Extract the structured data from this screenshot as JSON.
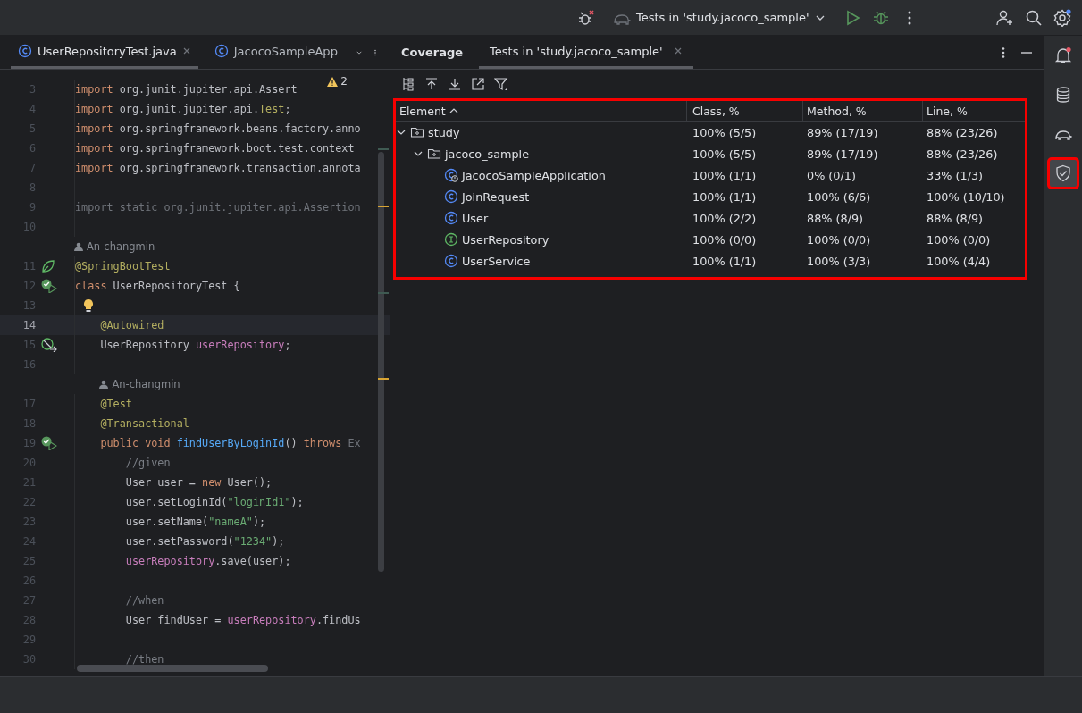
{
  "toolbar": {
    "run_config": "Tests in 'study.jacoco_sample'"
  },
  "editor": {
    "tabs": [
      {
        "label": "UserRepositoryTest.java",
        "selected": true,
        "closable": true
      },
      {
        "label": "JacocoSampleApp",
        "selected": false,
        "closable": false
      }
    ],
    "warnings": "2",
    "lines": [
      {
        "kind": "code",
        "number": "3",
        "tokens": [
          {
            "kind": "kw",
            "text": "import"
          },
          {
            "kind": "plain",
            "text": " org.junit.jupiter.api.Assert"
          }
        ]
      },
      {
        "kind": "code",
        "number": "4",
        "tokens": [
          {
            "kind": "kw",
            "text": "import"
          },
          {
            "kind": "plain",
            "text": " org.junit.jupiter.api."
          },
          {
            "kind": "ann",
            "text": "Test"
          },
          {
            "kind": "plain",
            "text": ";"
          }
        ]
      },
      {
        "kind": "code",
        "number": "5",
        "tokens": [
          {
            "kind": "kw",
            "text": "import"
          },
          {
            "kind": "plain",
            "text": " org.springframework.beans.factory.anno"
          }
        ]
      },
      {
        "kind": "code",
        "number": "6",
        "tokens": [
          {
            "kind": "kw",
            "text": "import"
          },
          {
            "kind": "plain",
            "text": " org.springframework.boot.test.context"
          }
        ]
      },
      {
        "kind": "code",
        "number": "7",
        "tokens": [
          {
            "kind": "kw",
            "text": "import"
          },
          {
            "kind": "plain",
            "text": " org.springframework.transaction.annota"
          }
        ]
      },
      {
        "kind": "code",
        "number": "8"
      },
      {
        "kind": "code",
        "number": "9",
        "tokens": [
          {
            "kind": "dim",
            "text": "import static org.junit.jupiter.api.Assertion"
          }
        ]
      },
      {
        "kind": "code",
        "number": "10"
      },
      {
        "kind": "author",
        "text": "An-changmin"
      },
      {
        "kind": "code",
        "number": "11",
        "marker": {
          "kind": "spring"
        },
        "tokens": [
          {
            "kind": "ann",
            "text": "@SpringBootTest"
          }
        ]
      },
      {
        "kind": "code",
        "number": "12",
        "marker": {
          "kind": "run"
        },
        "tokens": [
          {
            "kind": "kw",
            "text": "class"
          },
          {
            "kind": "plain",
            "text": " UserRepositoryTest {"
          }
        ]
      },
      {
        "kind": "code",
        "number": "13",
        "bulb": true
      },
      {
        "kind": "code",
        "number": "14",
        "current": true,
        "tokens": [
          {
            "kind": "ann",
            "text": "    @Autowired"
          }
        ]
      },
      {
        "kind": "code",
        "number": "15",
        "marker": {
          "kind": "bean"
        },
        "tokens": [
          {
            "kind": "plain",
            "text": "    UserRepository "
          },
          {
            "kind": "field",
            "text": "userRepository"
          },
          {
            "kind": "plain",
            "text": ";"
          }
        ]
      },
      {
        "kind": "code",
        "number": "16"
      },
      {
        "kind": "author",
        "text": "An-changmin"
      },
      {
        "kind": "code",
        "number": "17",
        "tokens": [
          {
            "kind": "ann",
            "text": "    @Test"
          }
        ]
      },
      {
        "kind": "code",
        "number": "18",
        "tokens": [
          {
            "kind": "ann",
            "text": "    @Transactional"
          }
        ]
      },
      {
        "kind": "code",
        "number": "19",
        "marker": {
          "kind": "run"
        },
        "tokens": [
          {
            "kind": "kw",
            "text": "    public void "
          },
          {
            "kind": "fn",
            "text": "findUserByLoginId"
          },
          {
            "kind": "plain",
            "text": "() "
          },
          {
            "kind": "kw",
            "text": "throws"
          },
          {
            "kind": "dim",
            "text": " Ex"
          }
        ]
      },
      {
        "kind": "code",
        "number": "20",
        "tokens": [
          {
            "kind": "comment",
            "text": "        //given"
          }
        ]
      },
      {
        "kind": "code",
        "number": "21",
        "tokens": [
          {
            "kind": "plain",
            "text": "        User user = "
          },
          {
            "kind": "kw",
            "text": "new"
          },
          {
            "kind": "plain",
            "text": " User();"
          }
        ]
      },
      {
        "kind": "code",
        "number": "22",
        "tokens": [
          {
            "kind": "plain",
            "text": "        user.setLoginId("
          },
          {
            "kind": "str",
            "text": "\"loginId1\""
          },
          {
            "kind": "plain",
            "text": ");"
          }
        ]
      },
      {
        "kind": "code",
        "number": "23",
        "tokens": [
          {
            "kind": "plain",
            "text": "        user.setName("
          },
          {
            "kind": "str",
            "text": "\"nameA\""
          },
          {
            "kind": "plain",
            "text": ");"
          }
        ]
      },
      {
        "kind": "code",
        "number": "24",
        "tokens": [
          {
            "kind": "plain",
            "text": "        user.setPassword("
          },
          {
            "kind": "str",
            "text": "\"1234\""
          },
          {
            "kind": "plain",
            "text": ");"
          }
        ]
      },
      {
        "kind": "code",
        "number": "25",
        "tokens": [
          {
            "kind": "field",
            "text": "        userRepository"
          },
          {
            "kind": "plain",
            "text": ".save(user);"
          }
        ]
      },
      {
        "kind": "code",
        "number": "26"
      },
      {
        "kind": "code",
        "number": "27",
        "tokens": [
          {
            "kind": "comment",
            "text": "        //when"
          }
        ]
      },
      {
        "kind": "code",
        "number": "28",
        "tokens": [
          {
            "kind": "plain",
            "text": "        User findUser = "
          },
          {
            "kind": "field",
            "text": "userRepository"
          },
          {
            "kind": "plain",
            "text": ".findUs"
          }
        ]
      },
      {
        "kind": "code",
        "number": "29"
      },
      {
        "kind": "code",
        "number": "30",
        "tokens": [
          {
            "kind": "comment",
            "text": "        //then"
          }
        ]
      }
    ]
  },
  "coverage": {
    "title": "Coverage",
    "tabs": [
      {
        "label": "Tests in 'study.jacoco_sample'",
        "selected": true
      }
    ],
    "highlighted": true,
    "columns": [
      {
        "label": "Element",
        "sorted": true
      },
      {
        "label": "Class, %",
        "sorted": false
      },
      {
        "label": "Method, %",
        "sorted": false
      },
      {
        "label": "Line, %",
        "sorted": false
      }
    ],
    "rows": [
      {
        "name": "study",
        "kind": "package",
        "expanded": true,
        "class": "100% (5/5)",
        "method": "89% (17/19)",
        "line": "88% (23/26)",
        "children": [
          {
            "name": "jacoco_sample",
            "kind": "package",
            "expanded": true,
            "class": "100% (5/5)",
            "method": "89% (17/19)",
            "line": "88% (23/26)",
            "children": [
              {
                "name": "JacocoSampleApplication",
                "kind": "app",
                "class": "100% (1/1)",
                "method": "0% (0/1)",
                "line": "33% (1/3)"
              },
              {
                "name": "JoinRequest",
                "kind": "class",
                "class": "100% (1/1)",
                "method": "100% (6/6)",
                "line": "100% (10/10)"
              },
              {
                "name": "User",
                "kind": "class",
                "class": "100% (2/2)",
                "method": "88% (8/9)",
                "line": "88% (8/9)"
              },
              {
                "name": "UserRepository",
                "kind": "interface",
                "class": "100% (0/0)",
                "method": "100% (0/0)",
                "line": "100% (0/0)"
              },
              {
                "name": "UserService",
                "kind": "class",
                "class": "100% (1/1)",
                "method": "100% (3/3)",
                "line": "100% (4/4)"
              }
            ]
          }
        ]
      }
    ]
  },
  "sidebar": [
    {
      "kind": "notifications",
      "selected": false,
      "highlighted": false
    },
    {
      "kind": "database",
      "selected": false,
      "highlighted": false
    },
    {
      "kind": "gradle",
      "selected": false,
      "highlighted": false
    },
    {
      "kind": "coverage",
      "selected": true,
      "highlighted": true
    }
  ]
}
